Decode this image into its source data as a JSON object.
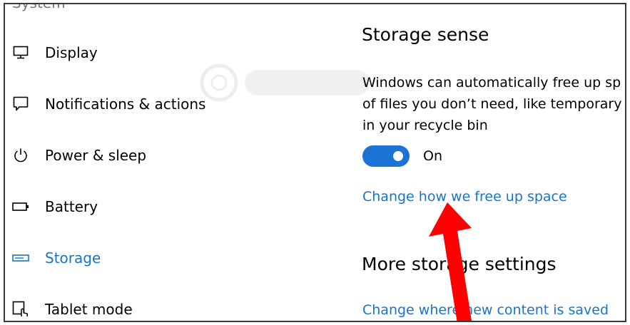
{
  "sidebar": {
    "section_title": "System",
    "items": [
      {
        "label": "Display",
        "icon": "monitor-icon"
      },
      {
        "label": "Notifications & actions",
        "icon": "speech-bubble-icon"
      },
      {
        "label": "Power & sleep",
        "icon": "power-icon"
      },
      {
        "label": "Battery",
        "icon": "battery-icon"
      },
      {
        "label": "Storage",
        "icon": "storage-icon",
        "active": true
      },
      {
        "label": "Tablet mode",
        "icon": "tablet-mode-icon"
      }
    ]
  },
  "main": {
    "storage_sense": {
      "title": "Storage sense",
      "description_lines": [
        "Windows can automatically free up sp",
        "of files you don’t need, like temporary",
        "in your recycle bin"
      ],
      "toggle_state": "On",
      "toggle_on": true,
      "link": "Change how we free up space"
    },
    "more_settings": {
      "title": "More storage settings",
      "link": "Change where new content is saved"
    }
  },
  "colors": {
    "accent": "#1b73c9",
    "toggle": "#1b73d6",
    "annotation_arrow": "#ff0000"
  }
}
